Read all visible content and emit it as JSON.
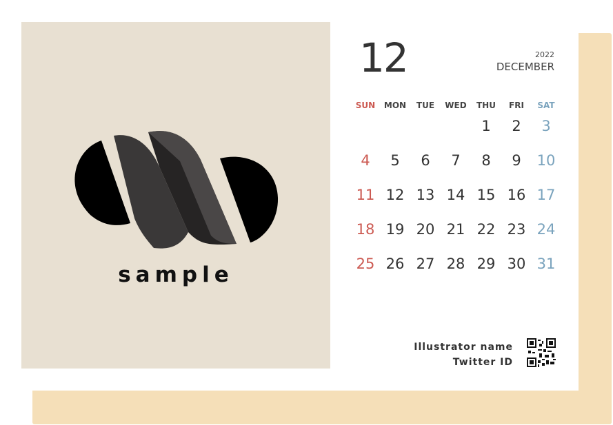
{
  "art": {
    "logo_text": "sample"
  },
  "calendar": {
    "month_number": "12",
    "year": "2022",
    "month_name": "DECEMBER",
    "weekdays": [
      "SUN",
      "MON",
      "TUE",
      "WED",
      "THU",
      "FRI",
      "SAT"
    ],
    "weeks": [
      [
        "",
        "",
        "",
        "",
        "1",
        "2",
        "3"
      ],
      [
        "4",
        "5",
        "6",
        "7",
        "8",
        "9",
        "10"
      ],
      [
        "11",
        "12",
        "13",
        "14",
        "15",
        "16",
        "17"
      ],
      [
        "18",
        "19",
        "20",
        "21",
        "22",
        "23",
        "24"
      ],
      [
        "25",
        "26",
        "27",
        "28",
        "29",
        "30",
        "31"
      ]
    ]
  },
  "credits": {
    "illustrator": "Illustrator name",
    "twitter": "Twitter ID"
  },
  "colors": {
    "sunday": "#cc5a52",
    "saturday": "#7aa3bd",
    "art_background": "#e8e0d2",
    "frame_shadow": "#f5dfb8"
  }
}
